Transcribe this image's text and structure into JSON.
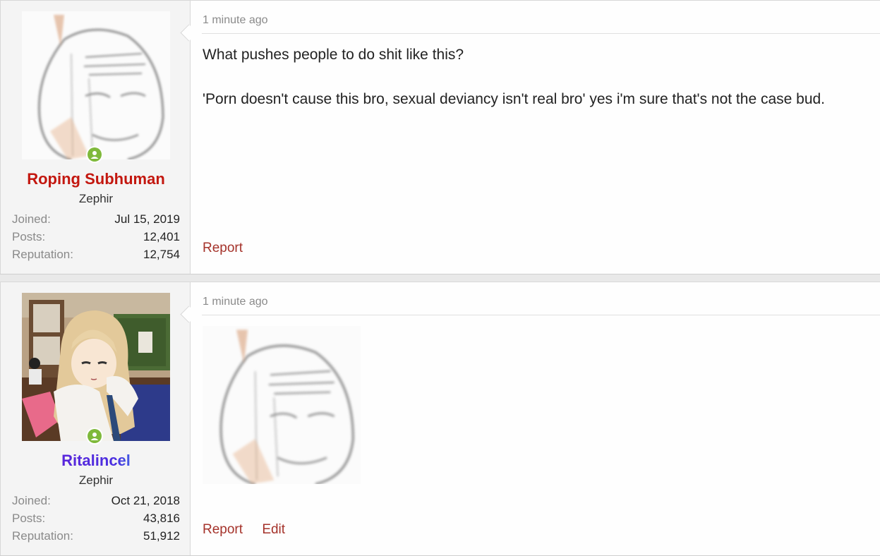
{
  "posts": [
    {
      "username": "Roping Subhuman",
      "user_title": "Zephir",
      "stats": [
        {
          "label": "Joined:",
          "value": "Jul 15, 2019"
        },
        {
          "label": "Posts:",
          "value": "12,401"
        },
        {
          "label": "Reputation:",
          "value": "12,754"
        }
      ],
      "time": "1 minute ago",
      "message": [
        "What pushes people to do shit like this?",
        "'Porn doesn't cause this bro, sexual deviancy isn't real bro' yes i'm sure that's not the case bud."
      ],
      "actions": [
        "Report"
      ]
    },
    {
      "username": "Ritalincel",
      "user_title": "Zephir",
      "stats": [
        {
          "label": "Joined:",
          "value": "Oct 21, 2018"
        },
        {
          "label": "Posts:",
          "value": "43,816"
        },
        {
          "label": "Reputation:",
          "value": "51,912"
        }
      ],
      "time": "1 minute ago",
      "actions": [
        "Report",
        "Edit"
      ]
    }
  ],
  "colors": {
    "username_red": "#c3170f",
    "online": "#7fb93b",
    "action_link": "#a5332b"
  },
  "icons": [
    "online-status-icon",
    "sketch-face-avatar",
    "anime-girl-avatar"
  ]
}
